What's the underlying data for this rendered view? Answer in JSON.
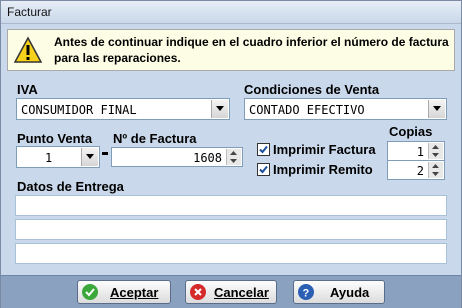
{
  "window": {
    "title": "Facturar"
  },
  "banner": {
    "message": "Antes de continuar indique en el cuadro inferior el número de factura para las reparaciones.",
    "icon": "warning-icon"
  },
  "iva": {
    "label": "IVA",
    "selected": "CONSUMIDOR FINAL"
  },
  "condiciones": {
    "label": "Condiciones de Venta",
    "selected": "CONTADO EFECTIVO"
  },
  "punto_venta": {
    "label": "Punto Venta",
    "value": "1"
  },
  "nro_factura": {
    "label": "Nº de Factura",
    "value": "1608"
  },
  "copias": {
    "label": "Copias"
  },
  "imprimir_factura": {
    "label": "Imprimir Factura",
    "checked": true,
    "copies": "1"
  },
  "imprimir_remito": {
    "label": "Imprimir Remito",
    "checked": true,
    "copies": "2"
  },
  "entrega": {
    "label": "Datos de Entrega",
    "lines": [
      "",
      "",
      ""
    ]
  },
  "buttons": {
    "aceptar": "Aceptar",
    "cancelar": "Cancelar",
    "ayuda": "Ayuda"
  },
  "colors": {
    "accent_green": "#3aa83a",
    "accent_red": "#d42a2a",
    "accent_blue": "#2b5fb3",
    "footer": "#8aa2c0"
  }
}
